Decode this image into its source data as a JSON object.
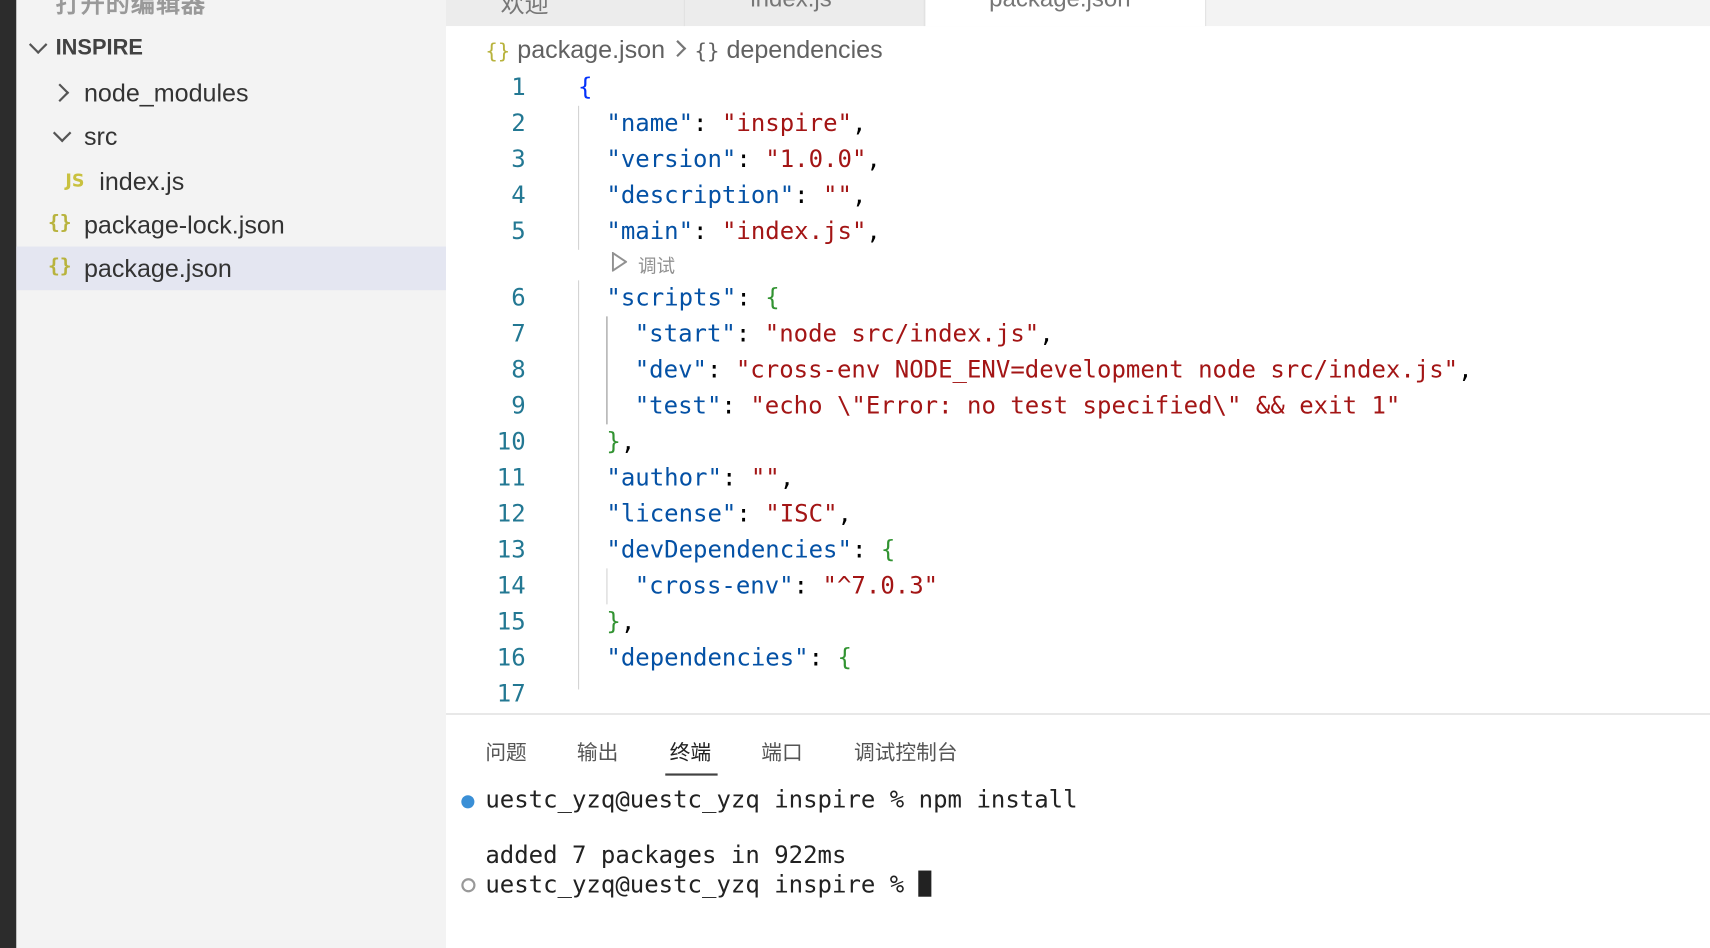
{
  "explorer": {
    "top_cut_label": "打开的编辑器",
    "root_label": "INSPIRE",
    "items": [
      {
        "label": "node_modules"
      },
      {
        "label": "src"
      },
      {
        "label": "index.js",
        "icon": "JS"
      },
      {
        "label": "package-lock.json",
        "icon": "{}"
      },
      {
        "label": "package.json",
        "icon": "{}"
      }
    ]
  },
  "tabs": [
    {
      "label": "欢迎"
    },
    {
      "label": "index.js"
    },
    {
      "label": "package.json"
    }
  ],
  "breadcrumb": {
    "file": "package.json",
    "symbol": "dependencies"
  },
  "editor": {
    "codelens": "调试",
    "line_numbers": [
      "1",
      "2",
      "3",
      "4",
      "5",
      "6",
      "7",
      "8",
      "9",
      "10",
      "11",
      "12",
      "13",
      "14",
      "15",
      "16",
      "17"
    ],
    "tokens": {
      "l1_brace": "{",
      "l2_key": "\"name\"",
      "l2_val": "\"inspire\"",
      "l3_key": "\"version\"",
      "l3_val": "\"1.0.0\"",
      "l4_key": "\"description\"",
      "l4_val": "\"\"",
      "l5_key": "\"main\"",
      "l5_val": "\"index.js\"",
      "l6_key": "\"scripts\"",
      "l6_brace": "{",
      "l7_key": "\"start\"",
      "l7_val": "\"node src/index.js\"",
      "l8_key": "\"dev\"",
      "l8_val": "\"cross-env NODE_ENV=development node src/index.js\"",
      "l9_key": "\"test\"",
      "l9_val": "\"echo \\\"Error: no test specified\\\" && exit 1\"",
      "l10_brace": "}",
      "l11_key": "\"author\"",
      "l11_val": "\"\"",
      "l12_key": "\"license\"",
      "l12_val": "\"ISC\"",
      "l13_key": "\"devDependencies\"",
      "l13_brace": "{",
      "l14_key": "\"cross-env\"",
      "l14_val": "\"^7.0.3\"",
      "l15_brace": "}",
      "l16_key": "\"dependencies\"",
      "l16_brace": "{",
      "colon": ": ",
      "comma": ","
    }
  },
  "panel": {
    "tabs": [
      "问题",
      "输出",
      "终端",
      "端口",
      "调试控制台"
    ],
    "active_tab": "终端",
    "terminal": {
      "line1": "uestc_yzq@uestc_yzq inspire % npm install",
      "line2": "added 7 packages in 922ms",
      "line3": "uestc_yzq@uestc_yzq inspire % "
    }
  },
  "colors": {
    "json_key": "#0451a5",
    "json_string": "#a31515",
    "bracket_level1": "#0431fa",
    "bracket_level2": "#319331",
    "line_number": "#237893",
    "selection": "#e4e6f1"
  }
}
